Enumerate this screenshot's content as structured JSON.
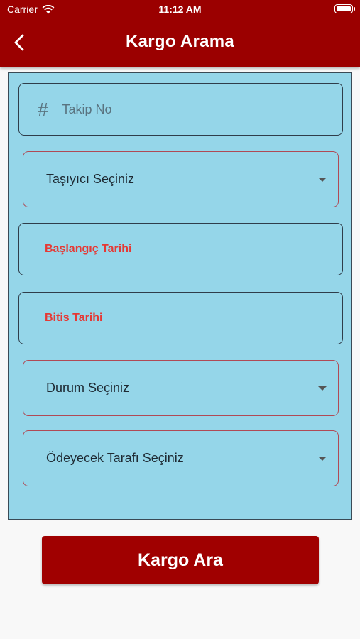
{
  "status_bar": {
    "carrier": "Carrier",
    "time": "11:12 AM"
  },
  "header": {
    "title": "Kargo Arama"
  },
  "form": {
    "tracking_placeholder": "Takip No",
    "tracking_icon": "#",
    "carrier_select": "Taşıyıcı Seçiniz",
    "start_date": "Başlangıç Tarihi",
    "end_date": "Bitis Tarihi",
    "status_select": "Durum Seçiniz",
    "payer_select": "Ödeyecek Tarafı Seçiniz"
  },
  "actions": {
    "search_label": "Kargo Ara"
  },
  "colors": {
    "primary": "#9b0000",
    "panel": "#95d6e9",
    "date_text": "#e53935"
  }
}
